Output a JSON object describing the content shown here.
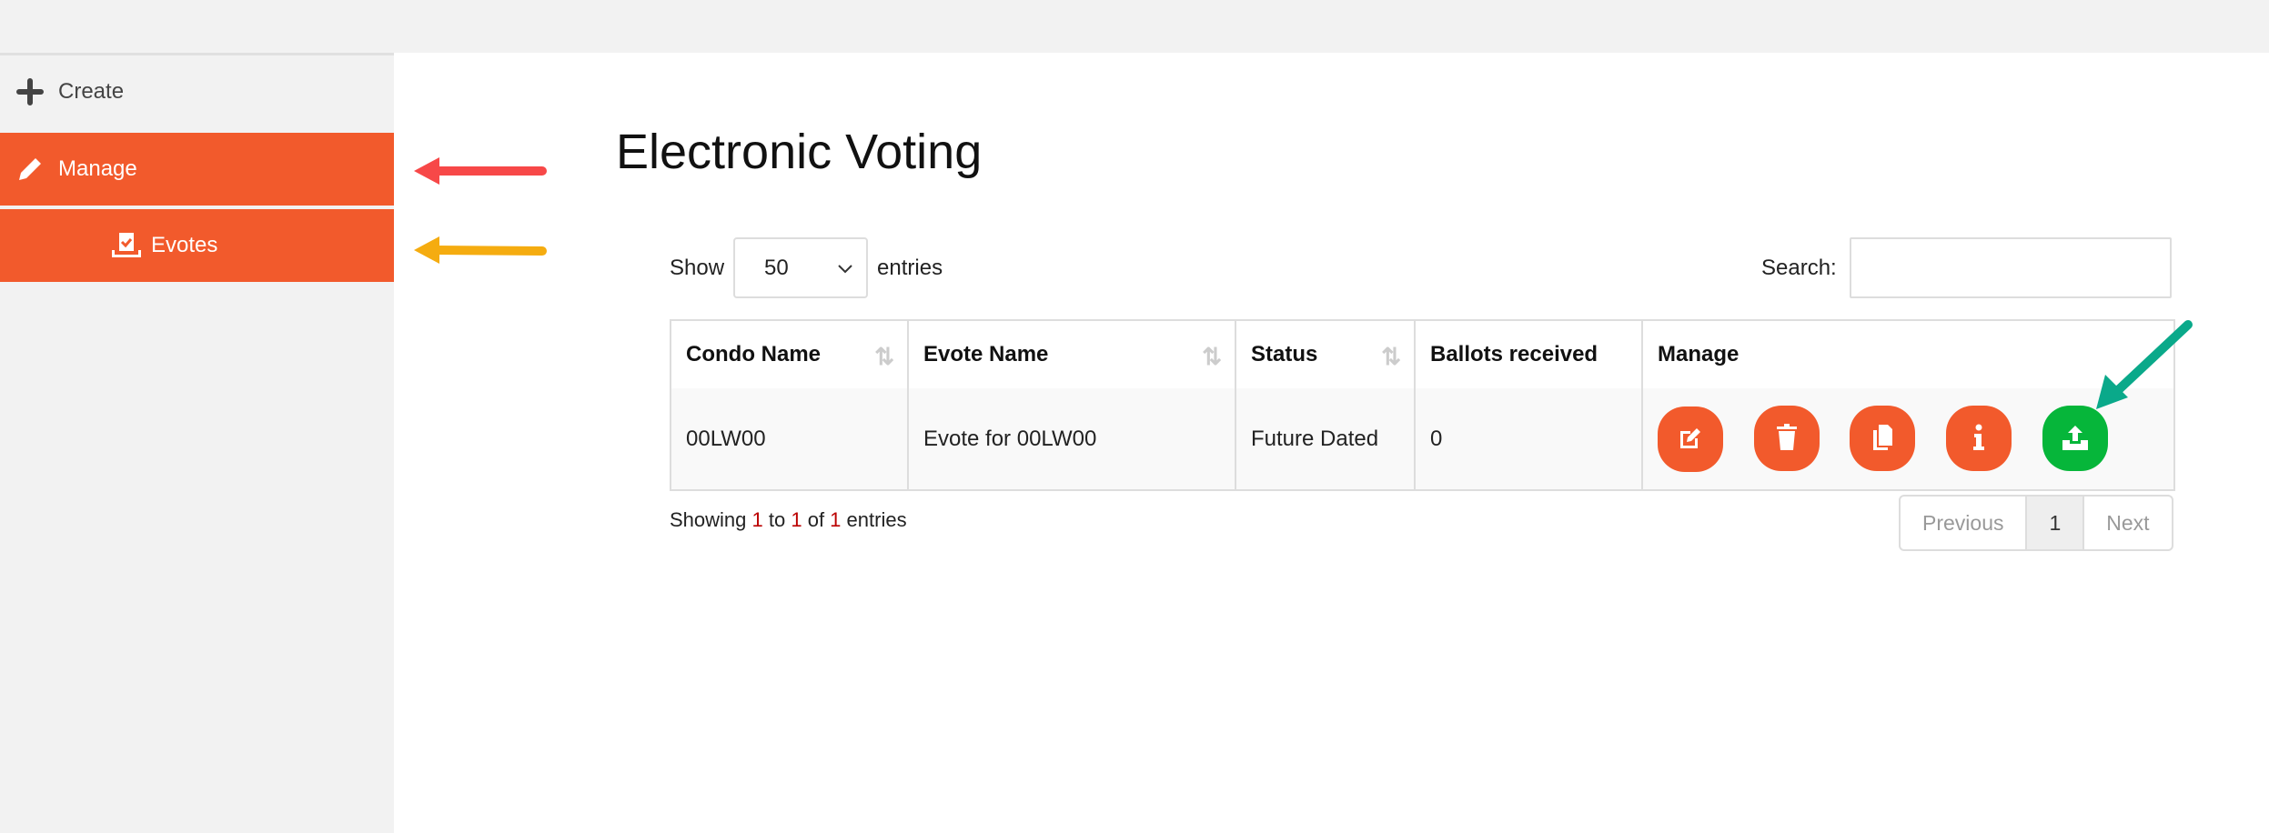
{
  "sidebar": {
    "items": [
      {
        "label": "Create",
        "icon": "plus-icon"
      },
      {
        "label": "Manage",
        "icon": "pencil-icon"
      },
      {
        "label": "Evotes",
        "icon": "ballot-box-icon"
      }
    ]
  },
  "title": "Electronic Voting",
  "length": {
    "show": "Show",
    "value": "50",
    "entries": "entries"
  },
  "search": {
    "label": "Search:",
    "value": ""
  },
  "table": {
    "headers": [
      "Condo Name",
      "Evote Name",
      "Status",
      "Ballots received",
      "Manage"
    ],
    "rows": [
      {
        "condo": "00LW00",
        "evote": "Evote for 00LW00",
        "status": "Future Dated",
        "ballots": "0"
      }
    ],
    "actions": [
      "edit-icon",
      "trash-icon",
      "copy-icon",
      "info-icon",
      "upload-icon"
    ]
  },
  "info": {
    "p1": "Showing ",
    "start": "1",
    "p2": " to ",
    "end": "1",
    "p3": " of ",
    "total": "1",
    "p4": " entries"
  },
  "pagination": {
    "previous": "Previous",
    "current": "1",
    "next": "Next"
  },
  "colors": {
    "accent": "#f25a2c",
    "upload": "#06b63a",
    "arrow_red": "#f74848",
    "arrow_yellow": "#f5ac10",
    "arrow_green": "#0aa98a"
  }
}
